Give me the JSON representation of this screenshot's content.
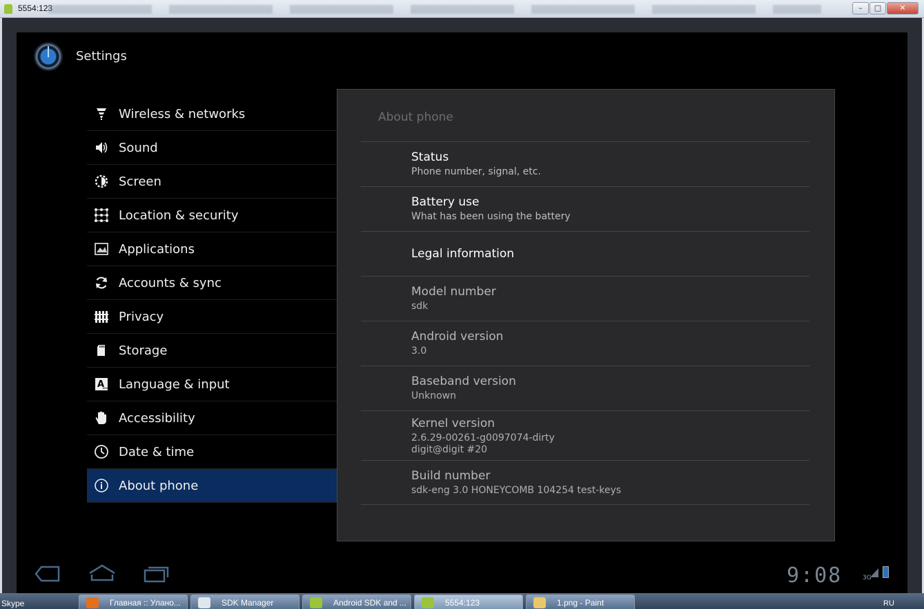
{
  "window": {
    "title": "5554:123",
    "min_label": "–",
    "max_label": "□",
    "close_label": "✕"
  },
  "app": {
    "title": "Settings"
  },
  "categories": [
    {
      "label": "Wireless & networks",
      "icon": "wireless-icon"
    },
    {
      "label": "Sound",
      "icon": "speaker-icon"
    },
    {
      "label": "Screen",
      "icon": "brightness-icon"
    },
    {
      "label": "Location & security",
      "icon": "grid-lock-icon"
    },
    {
      "label": "Applications",
      "icon": "applications-icon"
    },
    {
      "label": "Accounts & sync",
      "icon": "sync-icon"
    },
    {
      "label": "Privacy",
      "icon": "fence-icon"
    },
    {
      "label": "Storage",
      "icon": "sd-card-icon"
    },
    {
      "label": "Language & input",
      "icon": "language-icon"
    },
    {
      "label": "Accessibility",
      "icon": "hand-icon"
    },
    {
      "label": "Date & time",
      "icon": "clock-icon"
    },
    {
      "label": "About phone",
      "icon": "info-icon",
      "selected": true
    }
  ],
  "detail": {
    "header": "About phone",
    "status": {
      "title": "Status",
      "summary": "Phone number, signal, etc."
    },
    "battery": {
      "title": "Battery use",
      "summary": "What has been using the battery"
    },
    "legal": {
      "title": "Legal information"
    },
    "model": {
      "title": "Model number",
      "summary": "sdk"
    },
    "android": {
      "title": "Android version",
      "summary": "3.0"
    },
    "baseband": {
      "title": "Baseband version",
      "summary": "Unknown"
    },
    "kernel": {
      "title": "Kernel version",
      "line1": "2.6.29-00261-g0097074-dirty",
      "line2": "digit@digit #20"
    },
    "build": {
      "title": "Build number",
      "summary": "sdk-eng 3.0 HONEYCOMB 104254 test-keys"
    }
  },
  "system_bar": {
    "clock": "9:08",
    "network": "3G"
  },
  "taskbar": {
    "skype": "Skype",
    "items": [
      {
        "label": "Главная :: Улано...",
        "color": "#e4701e"
      },
      {
        "label": "SDK Manager",
        "color": "#dfe6ee"
      },
      {
        "label": "Android SDK and ...",
        "color": "#9ac43a"
      },
      {
        "label": "5554:123",
        "color": "#9ac43a"
      },
      {
        "label": "1.png - Paint",
        "color": "#e9c86a"
      }
    ],
    "lang": "RU"
  },
  "colors": {
    "selected": "#0a2c5e",
    "panel": "#29292b",
    "accent": "#2f79c9"
  }
}
